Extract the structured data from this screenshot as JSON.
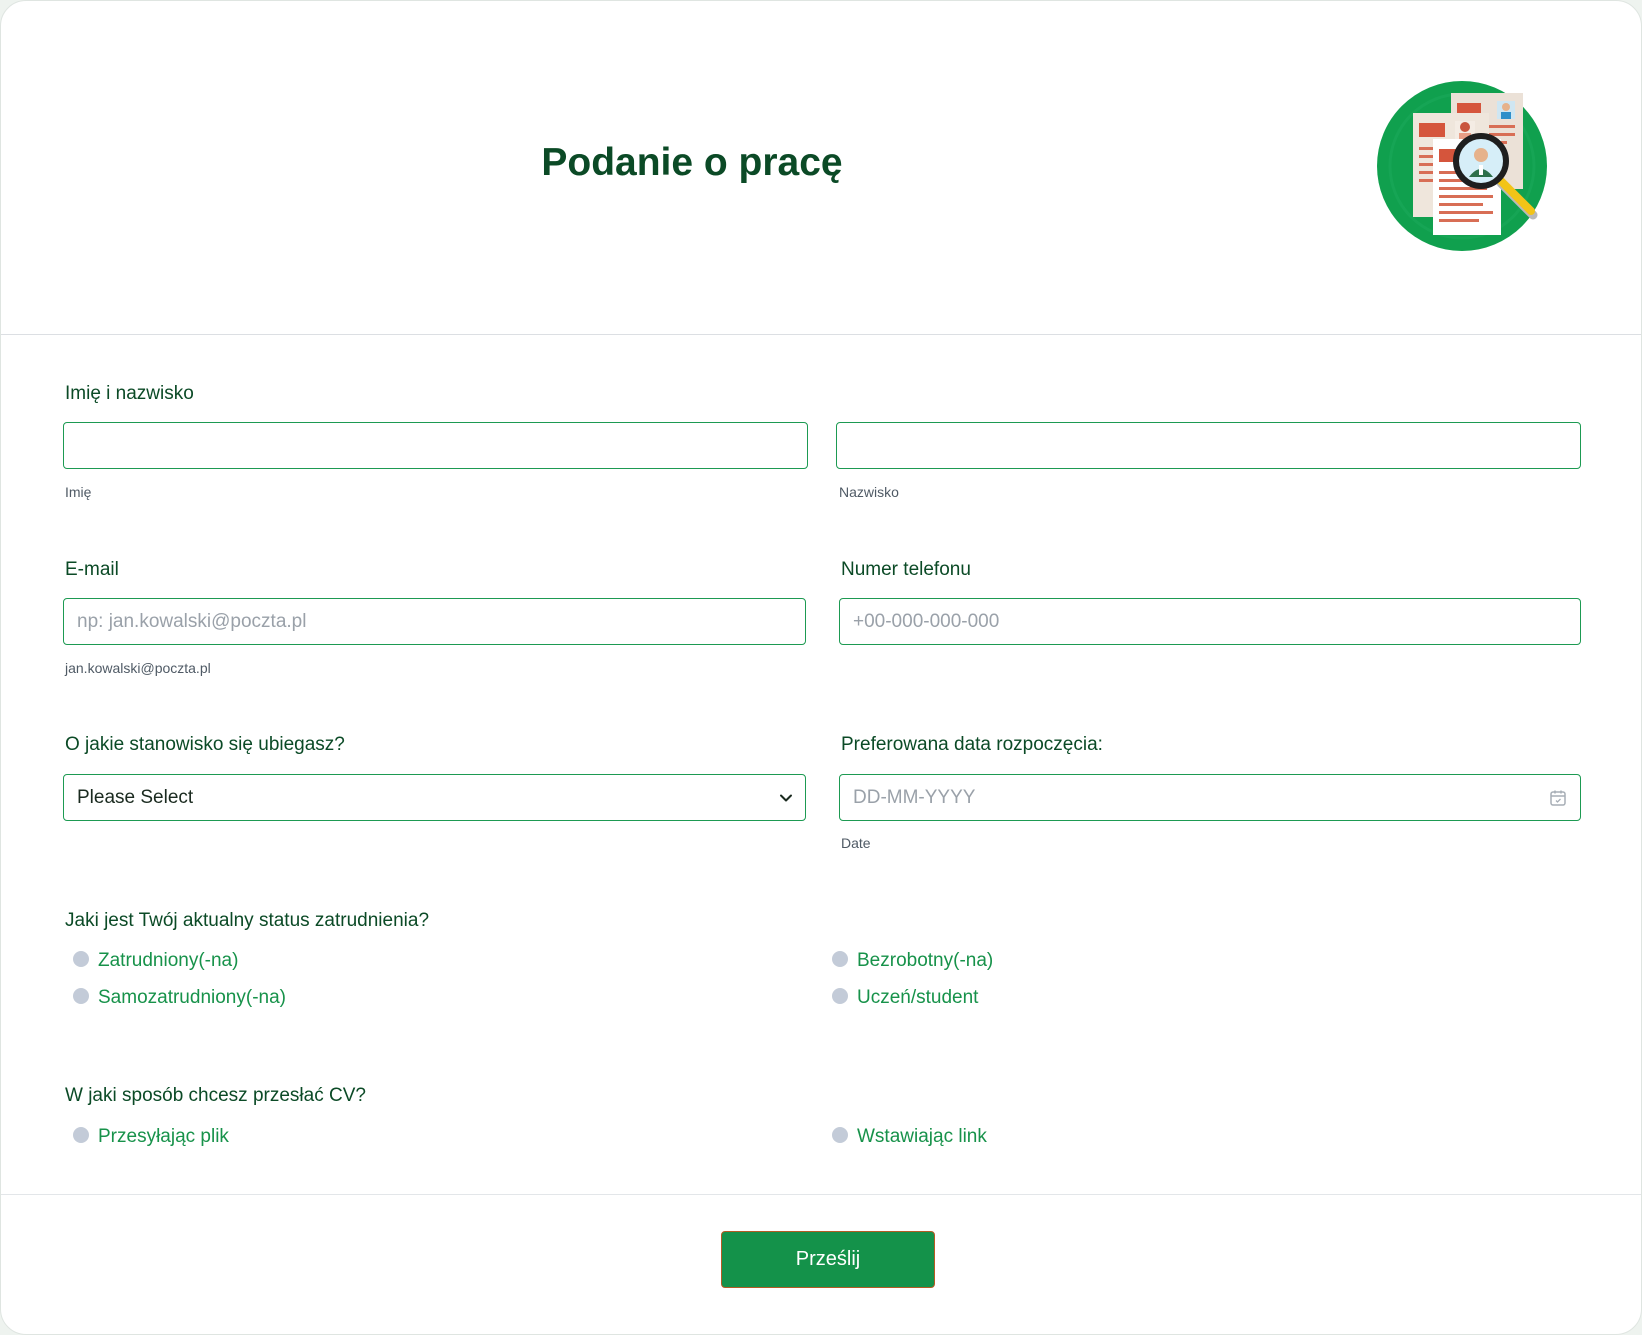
{
  "header": {
    "title": "Podanie o pracę",
    "logo_icon": "cv-search-icon"
  },
  "fields": {
    "name": {
      "label": "Imię i nazwisko",
      "first_sublabel": "Imię",
      "last_sublabel": "Nazwisko",
      "first_value": "",
      "last_value": ""
    },
    "email": {
      "label": "E-mail",
      "placeholder": "np: jan.kowalski@poczta.pl",
      "sublabel": "jan.kowalski@poczta.pl"
    },
    "phone": {
      "label": "Numer telefonu",
      "placeholder": "+00-000-000-000"
    },
    "position": {
      "label": "O jakie stanowisko się ubiegasz?",
      "selected": "Please Select"
    },
    "start_date": {
      "label": "Preferowana data rozpoczęcia:",
      "placeholder": "DD-MM-YYYY",
      "sublabel": "Date"
    }
  },
  "employment": {
    "label": "Jaki jest Twój aktualny status zatrudnienia?",
    "options": [
      "Zatrudniony(-na)",
      "Bezrobotny(-na)",
      "Samozatrudniony(-na)",
      "Uczeń/student"
    ]
  },
  "cv_method": {
    "label": "W jaki sposób chcesz przesłać CV?",
    "options": [
      "Przesyłając plik",
      "Wstawiając link"
    ]
  },
  "submit_label": "Prześlij",
  "colors": {
    "accent": "#14924a",
    "heading": "#0b4a26",
    "radio": "#c3cbd8"
  }
}
